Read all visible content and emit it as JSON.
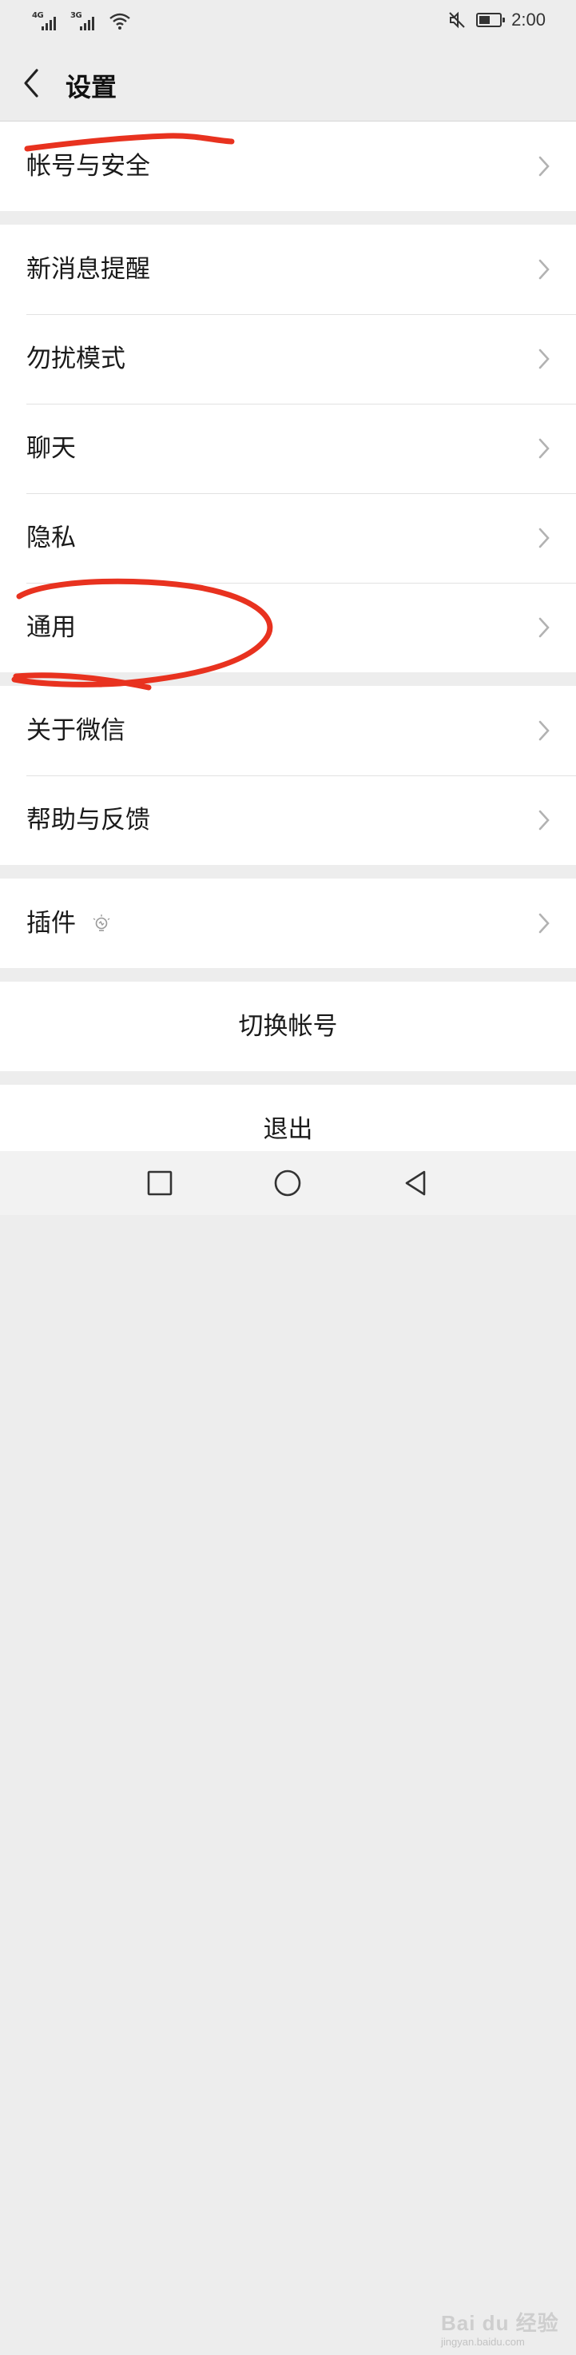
{
  "status_bar": {
    "network_1": "4G",
    "network_2": "3G",
    "time": "2:00",
    "icons": [
      "signal-icon",
      "wifi-icon",
      "mute-icon",
      "battery-icon"
    ]
  },
  "header": {
    "title": "设置"
  },
  "groups": [
    {
      "items": [
        {
          "label": "帐号与安全"
        }
      ]
    },
    {
      "items": [
        {
          "label": "新消息提醒"
        },
        {
          "label": "勿扰模式"
        },
        {
          "label": "聊天"
        },
        {
          "label": "隐私"
        },
        {
          "label": "通用"
        }
      ]
    },
    {
      "items": [
        {
          "label": "关于微信"
        },
        {
          "label": "帮助与反馈"
        }
      ]
    },
    {
      "items": [
        {
          "label": "插件",
          "icon": "lightbulb-icon"
        }
      ]
    }
  ],
  "actions": {
    "switch_account": "切换帐号",
    "logout": "退出"
  },
  "nav": {
    "icons": [
      "square-icon",
      "circle-icon",
      "triangle-back-icon"
    ]
  },
  "watermark": {
    "main": "Bai du 经验",
    "sub": "jingyan.baidu.com"
  },
  "colors": {
    "background": "#ededed",
    "annotation": "#e8321f",
    "text": "#1a1a1a"
  }
}
